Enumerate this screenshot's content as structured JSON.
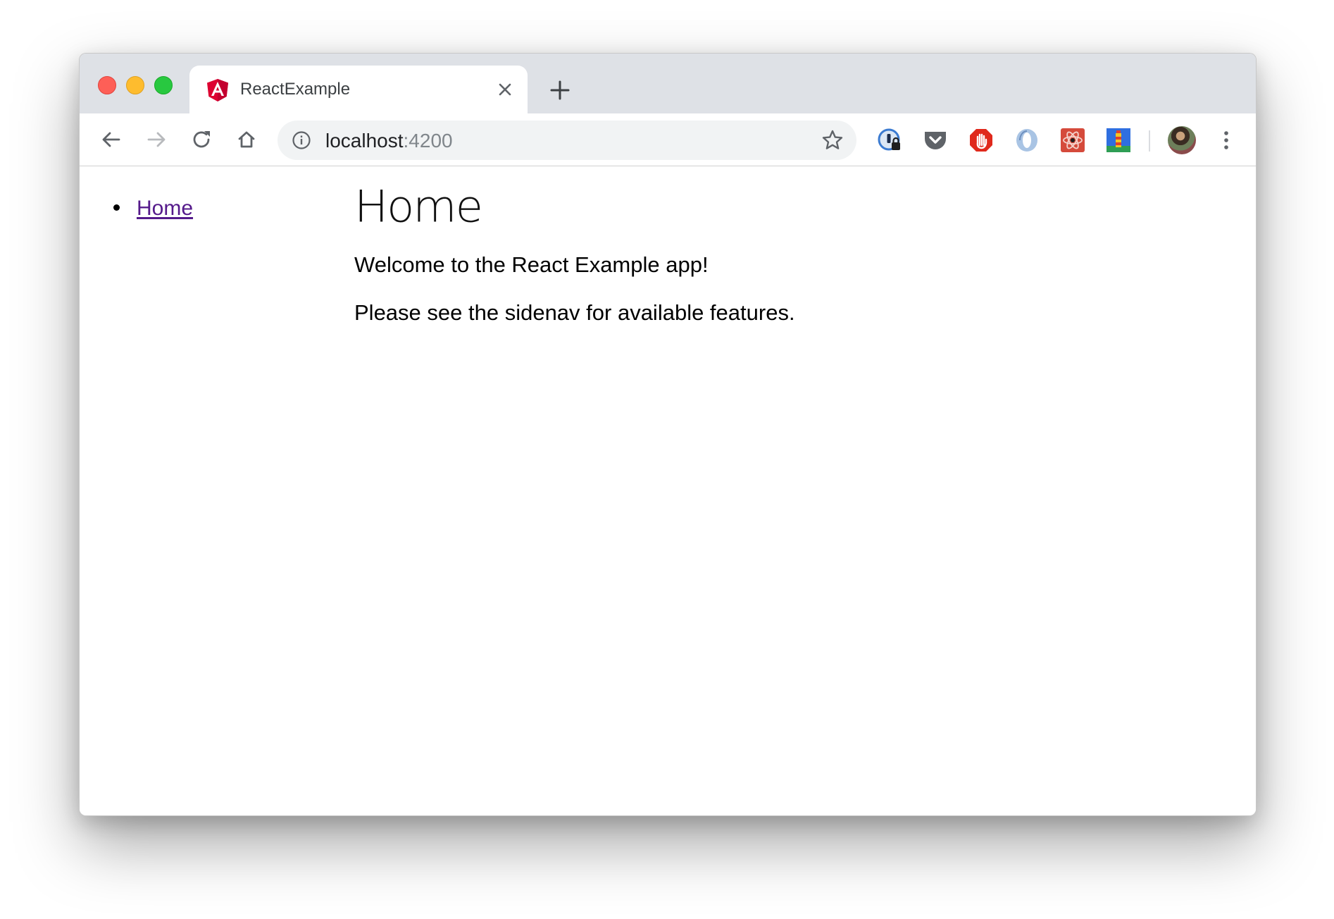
{
  "window": {
    "tab": {
      "title": "ReactExample",
      "favicon": "angular-logo-icon"
    },
    "traffic_lights": [
      "close",
      "minimize",
      "zoom"
    ]
  },
  "toolbar": {
    "url_host": "localhost",
    "url_port": ":4200",
    "extensions": [
      "1password-icon",
      "pocket-icon",
      "adblock-icon",
      "opera-icon",
      "react-devtools-icon",
      "lighthouse-icon"
    ]
  },
  "sidenav": {
    "items": [
      {
        "label": "Home"
      }
    ]
  },
  "main": {
    "heading": "Home",
    "paragraphs": [
      "Welcome to the React Example app!",
      "Please see the sidenav for available features."
    ]
  },
  "colors": {
    "tabstrip": "#dee1e6",
    "visited_link": "#551a8b",
    "angular_red": "#dd0031"
  }
}
